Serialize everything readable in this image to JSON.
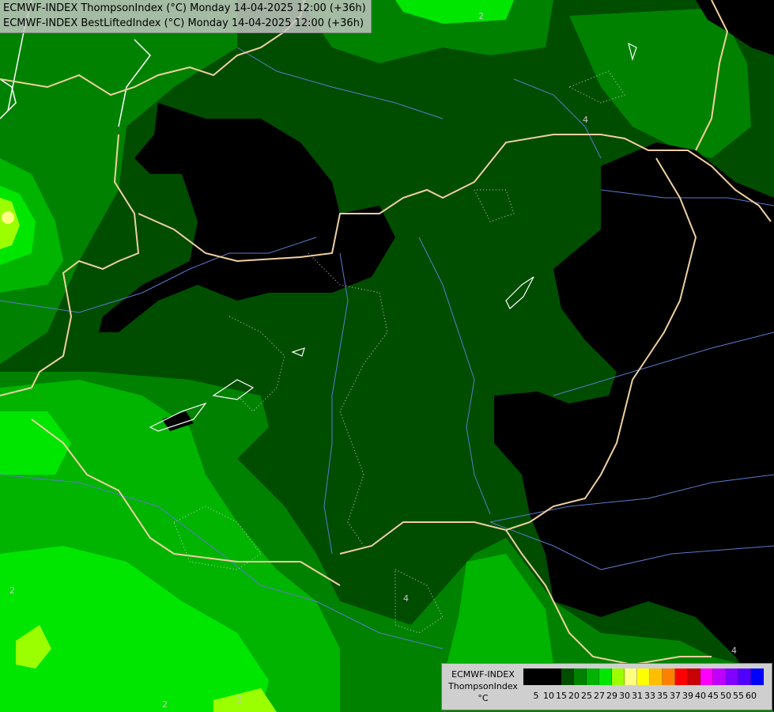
{
  "header": {
    "line1": "ECMWF-INDEX ThompsonIndex (°C) Monday 14-04-2025 12:00 (+36h)",
    "line2": "ECMWF-INDEX BestLiftedIndex (°C) Monday 14-04-2025 12:00 (+36h)"
  },
  "legend": {
    "title1": "ECMWF-INDEX",
    "title2": "ThompsonIndex",
    "unit": "°C",
    "colors": [
      "#000000",
      "#000000",
      "#000000",
      "#004d00",
      "#008200",
      "#00b400",
      "#00e600",
      "#9bff00",
      "#ffff80",
      "#ffff00",
      "#ffbf00",
      "#ff8000",
      "#ff0000",
      "#c80000",
      "#ff00ff",
      "#c000ff",
      "#8000ff",
      "#5000ff",
      "#0000ff"
    ],
    "ticks": [
      "5",
      "10",
      "15",
      "20",
      "25",
      "27",
      "29",
      "30",
      "31",
      "33",
      "35",
      "37",
      "39",
      "40",
      "45",
      "50",
      "55",
      "60"
    ]
  },
  "map_labels": {
    "c1": "2",
    "c2": "4",
    "c3": "2",
    "c4": "4",
    "c5": "2",
    "c6": "4",
    "c7": "2"
  },
  "colors": {
    "dark_green": "#004d00",
    "mid_green": "#008200",
    "green": "#00b400",
    "bright_green": "#00e600",
    "yellow_green": "#9bff00",
    "black": "#000000",
    "border": "#f0d0a0",
    "river": "#5a7acc"
  }
}
